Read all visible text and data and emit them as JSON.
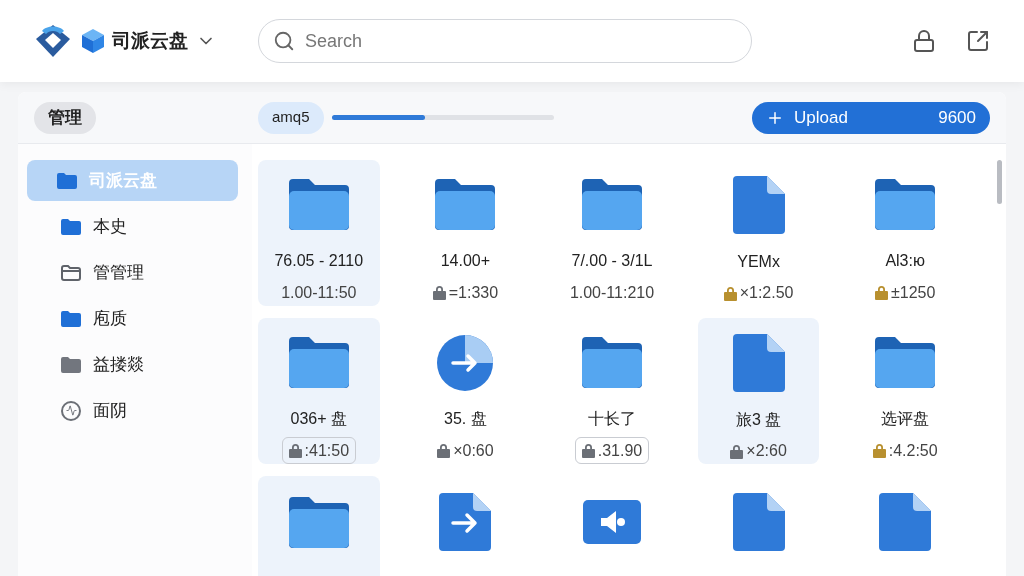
{
  "header": {
    "app_name": "司派云盘",
    "search": {
      "placeholder": "Search"
    }
  },
  "toolbar": {
    "manage_label": "管理",
    "zoom": {
      "label": "amq5",
      "level": 0.42
    },
    "upload": {
      "label": "Upload",
      "count": "9600"
    }
  },
  "sidebar": {
    "items": [
      {
        "label": "司派云盘",
        "kind": "folder",
        "selected": true
      },
      {
        "label": "本史",
        "kind": "folder",
        "selected": false
      },
      {
        "label": "管管理",
        "kind": "folder-outline",
        "selected": false
      },
      {
        "label": "庖质",
        "kind": "folder",
        "selected": false
      },
      {
        "label": "益搂燚",
        "kind": "folder-gray",
        "selected": false
      },
      {
        "label": "面阴",
        "kind": "activity",
        "selected": false
      }
    ]
  },
  "files": [
    {
      "kind": "folder",
      "name": "76.05 - 2110",
      "meta": "1.00-11:50",
      "boxed": false,
      "selected": true
    },
    {
      "kind": "folder",
      "name": "14.00+",
      "meta": "=1:330",
      "color": "#6b6f76",
      "boxed": false,
      "selected": false
    },
    {
      "kind": "folder",
      "name": "7/.00 - 3/1L",
      "meta": "1.00-11:210",
      "boxed": false,
      "selected": false
    },
    {
      "kind": "file",
      "name": "YEMx",
      "meta": "×1:2.50",
      "color": "#b8902f",
      "boxed": false,
      "selected": false
    },
    {
      "kind": "folder",
      "name": "Al3:ю",
      "meta": "±1250",
      "color": "#b8902f",
      "boxed": false,
      "selected": false
    },
    {
      "kind": "folder",
      "name": "036+ 盘",
      "meta": ":41:50",
      "color": "#6b6f76",
      "boxed": true,
      "selected": true
    },
    {
      "kind": "share",
      "name": "35. 盘",
      "meta": "×0:60",
      "color": "#6b6f76",
      "boxed": false,
      "selected": false
    },
    {
      "kind": "folder",
      "name": "十长了",
      "meta": ".31.90",
      "color": "#6b6f76",
      "boxed": true,
      "selected": false
    },
    {
      "kind": "file",
      "name": "旅3 盘",
      "meta": "×2:60",
      "color": "#6b6f76",
      "boxed": false,
      "selected": true
    },
    {
      "kind": "folder",
      "name": "选评盘",
      "meta": ":4.2:50",
      "color": "#b8902f",
      "boxed": false,
      "selected": false
    },
    {
      "kind": "folder",
      "selected": true
    },
    {
      "kind": "file-arrow",
      "selected": false
    },
    {
      "kind": "audio",
      "selected": false
    },
    {
      "kind": "file",
      "selected": false
    },
    {
      "kind": "file",
      "selected": false
    }
  ]
}
